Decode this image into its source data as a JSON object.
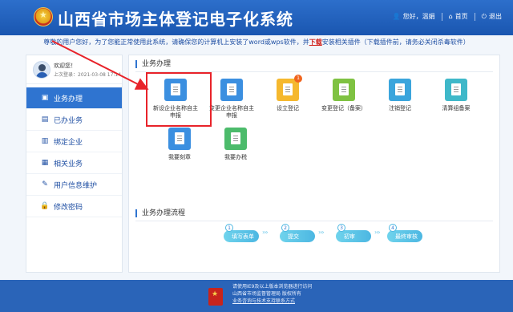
{
  "header": {
    "title": "山西省市场主体登记电子化系统",
    "user": "您好，温娟",
    "home": "首页",
    "logout": "退出"
  },
  "notice": {
    "before": "尊敬的用户您好，为了您能正常使用此系统，请确保您的计算机上安装了word或wps软件，并",
    "link": "下载",
    "after": "安装相关插件（下载插件前，请务必关闭杀毒软件）"
  },
  "sidebar": {
    "welcome": "欢迎您！",
    "last_login": "上次登录：2021-03-08 17:14",
    "items": [
      {
        "label": "业务办理",
        "icon": "briefcase-icon"
      },
      {
        "label": "已办业务",
        "icon": "document-icon"
      },
      {
        "label": "绑定企业",
        "icon": "building-icon"
      },
      {
        "label": "相关业务",
        "icon": "grid-icon"
      },
      {
        "label": "用户信息维护",
        "icon": "user-wrench-icon"
      },
      {
        "label": "修改密码",
        "icon": "lock-icon"
      }
    ]
  },
  "main": {
    "section1_title": "业务办理",
    "section2_title": "业务办理流程",
    "tiles": [
      {
        "label": "新设企业名称自主申报",
        "color": "#3b8fe0"
      },
      {
        "label": "变更企业名称自主申报",
        "color": "#3b8fe0"
      },
      {
        "label": "设立登记",
        "color": "#f5b82e",
        "badge": "1"
      },
      {
        "label": "变更登记（备案）",
        "color": "#7fc242"
      },
      {
        "label": "注销登记",
        "color": "#3ba5dc"
      },
      {
        "label": "清算组备案",
        "color": "#3fb8c9"
      },
      {
        "label": "我要刻章",
        "color": "#3b8fe0"
      },
      {
        "label": "我要办税",
        "color": "#4cbb6b"
      }
    ],
    "flow_steps": [
      {
        "num": "1",
        "label": "填写表单"
      },
      {
        "num": "2",
        "label": "提交"
      },
      {
        "num": "3",
        "label": "初审"
      },
      {
        "num": "4",
        "label": "最终审核"
      }
    ]
  },
  "footer": {
    "line1": "请使用IE9及以上版本浏览器进行访问",
    "line2": "山西省市场监督管理局 版权所有",
    "line3": "业务咨询与技术支持联系方式"
  }
}
